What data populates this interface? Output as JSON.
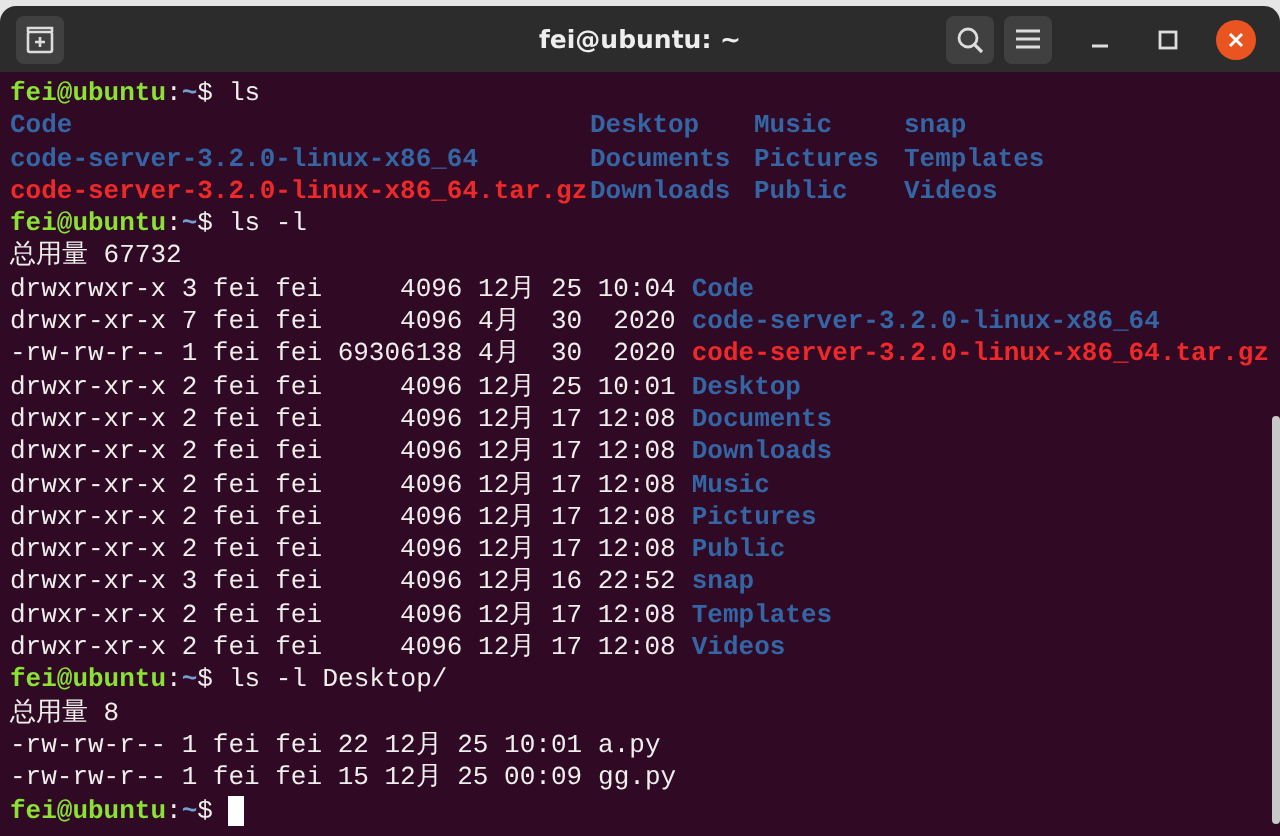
{
  "window": {
    "title": "fei@ubuntu: ~"
  },
  "lines": [
    {
      "kind": "prompt",
      "user_host": "fei@ubuntu",
      "separator": ":",
      "path": "~",
      "symbol": "$",
      "command": "ls"
    },
    {
      "kind": "grid",
      "rows": [
        [
          {
            "name": "Code",
            "color": "#3465a4"
          },
          {
            "name": "Desktop",
            "color": "#3465a4"
          },
          {
            "name": "Music",
            "color": "#3465a4"
          },
          {
            "name": "snap",
            "color": "#3465a4"
          }
        ],
        [
          {
            "name": "code-server-3.2.0-linux-x86_64",
            "color": "#3465a4"
          },
          {
            "name": "Documents",
            "color": "#3465a4"
          },
          {
            "name": "Pictures",
            "color": "#3465a4"
          },
          {
            "name": "Templates",
            "color": "#3465a4"
          }
        ],
        [
          {
            "name": "code-server-3.2.0-linux-x86_64.tar.gz",
            "color": "#ef2929"
          },
          {
            "name": "Downloads",
            "color": "#3465a4"
          },
          {
            "name": "Public",
            "color": "#3465a4"
          },
          {
            "name": "Videos",
            "color": "#3465a4"
          }
        ]
      ]
    },
    {
      "kind": "prompt",
      "user_host": "fei@ubuntu",
      "separator": ":",
      "path": "~",
      "symbol": "$",
      "command": "ls -l"
    },
    {
      "kind": "text",
      "text": "总用量 67732"
    },
    {
      "kind": "listing",
      "rows": [
        {
          "meta": "drwxrwxr-x 3 fei fei     4096 12月 25 10:04",
          "name": "Code",
          "color": "#3465a4"
        },
        {
          "meta": "drwxr-xr-x 7 fei fei     4096 4月  30  2020",
          "name": "code-server-3.2.0-linux-x86_64",
          "color": "#3465a4"
        },
        {
          "meta": "-rw-rw-r-- 1 fei fei 69306138 4月  30  2020",
          "name": "code-server-3.2.0-linux-x86_64.tar.gz",
          "color": "#ef2929"
        },
        {
          "meta": "drwxr-xr-x 2 fei fei     4096 12月 25 10:01",
          "name": "Desktop",
          "color": "#3465a4"
        },
        {
          "meta": "drwxr-xr-x 2 fei fei     4096 12月 17 12:08",
          "name": "Documents",
          "color": "#3465a4"
        },
        {
          "meta": "drwxr-xr-x 2 fei fei     4096 12月 17 12:08",
          "name": "Downloads",
          "color": "#3465a4"
        },
        {
          "meta": "drwxr-xr-x 2 fei fei     4096 12月 17 12:08",
          "name": "Music",
          "color": "#3465a4"
        },
        {
          "meta": "drwxr-xr-x 2 fei fei     4096 12月 17 12:08",
          "name": "Pictures",
          "color": "#3465a4"
        },
        {
          "meta": "drwxr-xr-x 2 fei fei     4096 12月 17 12:08",
          "name": "Public",
          "color": "#3465a4"
        },
        {
          "meta": "drwxr-xr-x 3 fei fei     4096 12月 16 22:52",
          "name": "snap",
          "color": "#3465a4"
        },
        {
          "meta": "drwxr-xr-x 2 fei fei     4096 12月 17 12:08",
          "name": "Templates",
          "color": "#3465a4"
        },
        {
          "meta": "drwxr-xr-x 2 fei fei     4096 12月 17 12:08",
          "name": "Videos",
          "color": "#3465a4"
        }
      ]
    },
    {
      "kind": "prompt",
      "user_host": "fei@ubuntu",
      "separator": ":",
      "path": "~",
      "symbol": "$",
      "command": "ls -l Desktop/"
    },
    {
      "kind": "text",
      "text": "总用量 8"
    },
    {
      "kind": "listing",
      "rows": [
        {
          "meta": "-rw-rw-r-- 1 fei fei 22 12月 25 10:01",
          "name": "a.py",
          "color": "#eeeeec"
        },
        {
          "meta": "-rw-rw-r-- 1 fei fei 15 12月 25 00:09",
          "name": "gg.py",
          "color": "#eeeeec"
        }
      ]
    },
    {
      "kind": "input",
      "user_host": "fei@ubuntu",
      "separator": ":",
      "path": "~",
      "symbol": "$"
    }
  ]
}
